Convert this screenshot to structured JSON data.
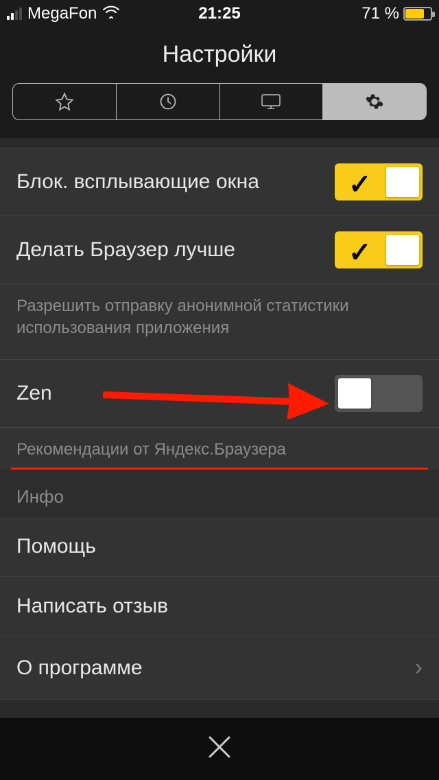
{
  "statusbar": {
    "carrier": "MegaFon",
    "time": "21:25",
    "battery_text": "71 %"
  },
  "header": {
    "title": "Настройки"
  },
  "settings": {
    "block_popups": {
      "label": "Блок. всплывающие окна",
      "on": true
    },
    "improve_browser": {
      "label": "Делать Браузер лучше",
      "on": true,
      "footnote": "Разрешить отправку анонимной статистики использования приложения"
    },
    "zen": {
      "label": "Zen",
      "on": false,
      "footnote": "Рекомендации от Яндекс.Браузера"
    }
  },
  "info_section": {
    "header": "Инфо",
    "help": "Помощь",
    "feedback": "Написать отзыв",
    "about": "О программе"
  },
  "icons": {
    "star": "star-icon",
    "history": "history-icon",
    "desktop": "desktop-icon",
    "gear": "gear-icon",
    "close": "close-icon",
    "wifi": "wifi-icon",
    "chevron": "chevron-right-icon"
  },
  "colors": {
    "accent_yellow": "#f9cc1a",
    "arrow_red": "#ff1a00"
  }
}
